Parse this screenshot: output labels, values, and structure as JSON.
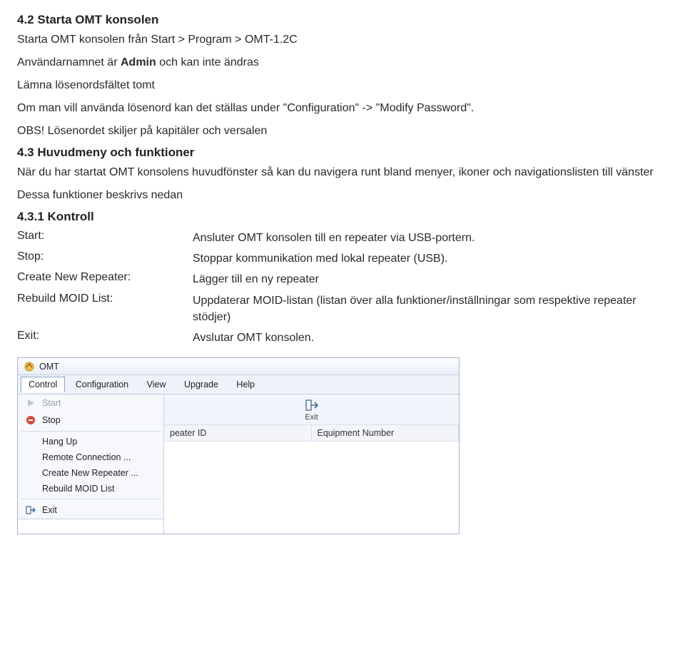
{
  "s42": {
    "heading": "4.2 Starta OMT konsolen",
    "line1_a": "Starta OMT konsolen från Start > Program > OMT-1.2C",
    "line2_pre": "Användarnamnet är ",
    "line2_bold": "Admin",
    "line2_post": " och kan inte ändras",
    "line3": "Lämna lösenordsfältet tomt",
    "line4": "Om man vill använda lösenord kan det ställas under \"Configuration\" -> \"Modify Password\".",
    "line5": "OBS! Lösenordet skiljer på kapitäler och versalen"
  },
  "s43": {
    "heading": "4.3 Huvudmeny och funktioner",
    "p1": "När du har startat OMT konsolens huvudfönster så kan du navigera runt bland menyer, ikoner och navigationslisten till vänster",
    "p2": "Dessa funktioner beskrivs nedan"
  },
  "s431": {
    "heading": "4.3.1 Kontroll",
    "rows": [
      {
        "term": "Start:",
        "def": "Ansluter OMT konsolen till en repeater via USB-portern."
      },
      {
        "term": "Stop:",
        "def": "Stoppar kommunikation med lokal repeater (USB)."
      },
      {
        "term": "Create New Repeater:",
        "def": "Lägger till en ny repeater"
      },
      {
        "term": "Rebuild MOID List:",
        "def": "Uppdaterar MOID-listan (listan över alla funktioner/inställningar som respektive repeater stödjer)"
      },
      {
        "term": "Exit:",
        "def": "Avslutar OMT konsolen."
      }
    ]
  },
  "omt": {
    "title": "OMT",
    "menus": [
      "Control",
      "Configuration",
      "View",
      "Upgrade",
      "Help"
    ],
    "dropdown": [
      {
        "label": "Start",
        "icon": "play",
        "disabled": true
      },
      {
        "label": "Stop",
        "icon": "stop",
        "disabled": false
      },
      {
        "sep": true
      },
      {
        "label": "Hang Up",
        "indent": true
      },
      {
        "label": "Remote Connection ...",
        "indent": true
      },
      {
        "label": "Create New Repeater ...",
        "indent": true
      },
      {
        "label": "Rebuild MOID List",
        "indent": true
      },
      {
        "sep": true
      },
      {
        "label": "Exit",
        "icon": "exit"
      }
    ],
    "toolbar": {
      "exit_label": "Exit"
    },
    "grid_headers": [
      "peater ID",
      "Equipment Number"
    ]
  }
}
